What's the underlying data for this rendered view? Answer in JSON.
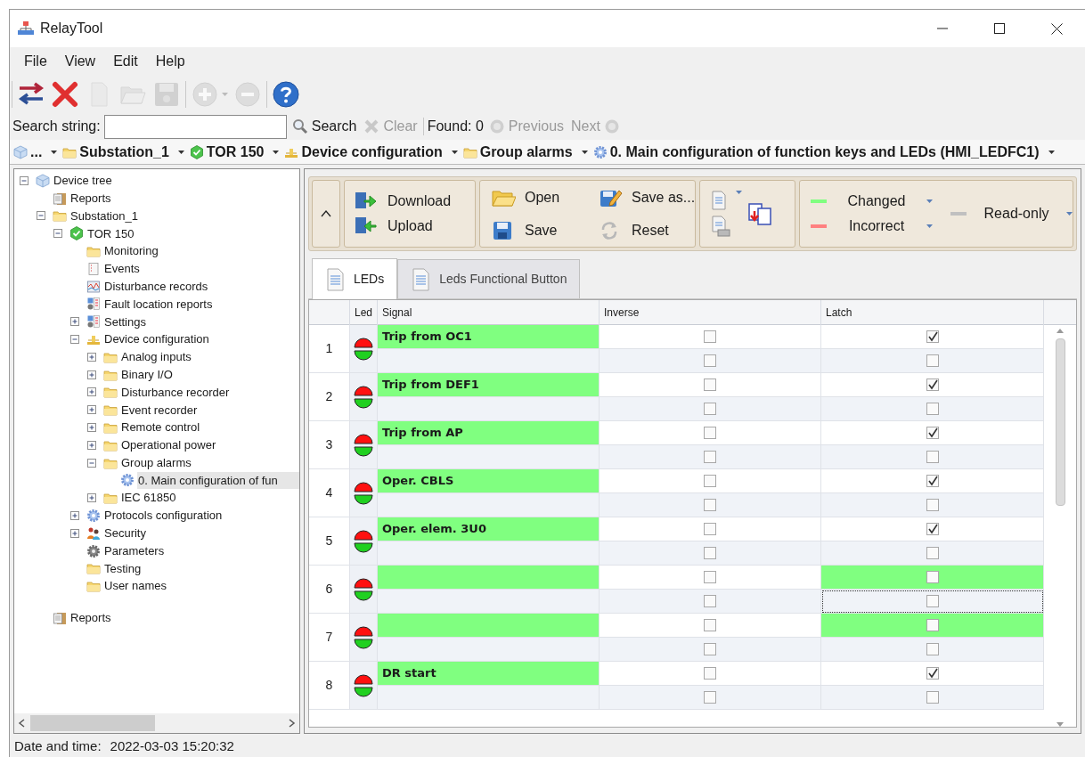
{
  "window": {
    "title": "RelayTool"
  },
  "menu": [
    "File",
    "View",
    "Edit",
    "Help"
  ],
  "toolbar": [
    {
      "kind": "swap",
      "disabled": false
    },
    {
      "kind": "delete",
      "disabled": false
    },
    {
      "kind": "new",
      "disabled": true
    },
    {
      "kind": "open",
      "disabled": true
    },
    {
      "kind": "save",
      "disabled": true
    },
    {
      "kind": "add",
      "disabled": true
    },
    {
      "kind": "remove",
      "disabled": true
    },
    {
      "kind": "help",
      "disabled": false
    }
  ],
  "search": {
    "label": "Search string:",
    "search_button": "Search",
    "clear_button": {
      "label": "Clear",
      "disabled": true
    },
    "found": "Found: 0",
    "previous_button": {
      "label": "Previous",
      "disabled": true
    },
    "next_button": {
      "label": "Next",
      "disabled": true
    }
  },
  "breadcrumb": [
    {
      "label": "...",
      "kind": "cube"
    },
    {
      "label": "Substation_1",
      "kind": "folder"
    },
    {
      "label": "TOR 150",
      "kind": "check"
    },
    {
      "label": "Device configuration",
      "kind": "device-config"
    },
    {
      "label": "Group alarms",
      "kind": "folder"
    },
    {
      "label": "0. Main configuration of function keys and LEDs (HMI_LEDFC1)",
      "kind": "gear"
    }
  ],
  "tree": [
    {
      "label": "Device tree",
      "kind": "cube",
      "expanded": true,
      "selected": false,
      "children": [
        {
          "label": "Reports",
          "kind": "report",
          "selected": false
        },
        {
          "label": "Substation_1",
          "kind": "folder",
          "expanded": true,
          "selected": false,
          "children": [
            {
              "label": "TOR 150",
              "kind": "check",
              "expanded": true,
              "selected": false,
              "children": [
                {
                  "label": "Monitoring",
                  "kind": "folder",
                  "selected": false
                },
                {
                  "label": "Events",
                  "kind": "events",
                  "selected": false
                },
                {
                  "label": "Disturbance records",
                  "kind": "disturbance",
                  "selected": false
                },
                {
                  "label": "Fault location reports",
                  "kind": "fault",
                  "selected": false
                },
                {
                  "label": "Settings",
                  "kind": "fault",
                  "expanded": false,
                  "selected": false
                },
                {
                  "label": "Device configuration",
                  "kind": "device-config",
                  "expanded": true,
                  "selected": false,
                  "children": [
                    {
                      "label": "Analog inputs",
                      "kind": "folder",
                      "expanded": false,
                      "selected": false
                    },
                    {
                      "label": "Binary I/O",
                      "kind": "folder",
                      "expanded": false,
                      "selected": false
                    },
                    {
                      "label": "Disturbance recorder",
                      "kind": "folder",
                      "expanded": false,
                      "selected": false
                    },
                    {
                      "label": "Event recorder",
                      "kind": "folder",
                      "expanded": false,
                      "selected": false
                    },
                    {
                      "label": "Remote control",
                      "kind": "folder",
                      "expanded": false,
                      "selected": false
                    },
                    {
                      "label": "Operational power",
                      "kind": "folder",
                      "expanded": false,
                      "selected": false
                    },
                    {
                      "label": "Group alarms",
                      "kind": "folder",
                      "expanded": true,
                      "selected": false,
                      "children": [
                        {
                          "label": "0. Main configuration of fun",
                          "kind": "gear",
                          "selected": true
                        }
                      ]
                    },
                    {
                      "label": "IEC 61850",
                      "kind": "folder",
                      "expanded": false,
                      "selected": false
                    }
                  ]
                },
                {
                  "label": "Protocols configuration",
                  "kind": "gear",
                  "expanded": false,
                  "selected": false
                },
                {
                  "label": "Security",
                  "kind": "people",
                  "expanded": false,
                  "selected": false
                },
                {
                  "label": "Parameters",
                  "kind": "parameters",
                  "selected": false
                },
                {
                  "label": "Testing",
                  "kind": "folder",
                  "selected": false
                },
                {
                  "label": "User names",
                  "kind": "folder",
                  "selected": false
                }
              ]
            }
          ]
        },
        {
          "label": "Reports",
          "kind": "report",
          "selected": false
        }
      ]
    }
  ],
  "ribbon": {
    "transfer": [
      {
        "label": "Download",
        "kind": "download"
      },
      {
        "label": "Upload",
        "kind": "upload"
      }
    ],
    "file": [
      {
        "label": "Open",
        "kind": "open"
      },
      {
        "label": "Save as...",
        "kind": "save-as"
      },
      {
        "label": "Save",
        "kind": "save"
      },
      {
        "label": "Reset",
        "kind": "reset"
      }
    ],
    "legend": [
      {
        "label": "Changed",
        "color": "#80ff80"
      },
      {
        "label": "Incorrect",
        "color": "#ff8080"
      },
      {
        "label": "Read-only",
        "color": "#c0c0c0"
      }
    ]
  },
  "tabs": [
    {
      "label": "LEDs",
      "selected": true
    },
    {
      "label": "Leds Functional Button",
      "selected": false
    }
  ],
  "table": {
    "columns": [
      "Led",
      "Signal",
      "Inverse",
      "Latch"
    ],
    "rows": [
      {
        "number": "1",
        "lines": [
          {
            "signal": "Trip from OC1",
            "signal_changed": true,
            "inverse": false,
            "latch": true,
            "latch_changed": false,
            "focused": false
          },
          {
            "signal_changed": false,
            "inverse": false,
            "latch": false,
            "latch_changed": false,
            "focused": false
          }
        ]
      },
      {
        "number": "2",
        "lines": [
          {
            "signal": "Trip from DEF1",
            "signal_changed": true,
            "inverse": false,
            "latch": true,
            "latch_changed": false,
            "focused": false
          },
          {
            "signal_changed": false,
            "inverse": false,
            "latch": false,
            "latch_changed": false,
            "focused": false
          }
        ]
      },
      {
        "number": "3",
        "lines": [
          {
            "signal": "Trip from AP",
            "signal_changed": true,
            "inverse": false,
            "latch": true,
            "latch_changed": false,
            "focused": false
          },
          {
            "signal_changed": false,
            "inverse": false,
            "latch": false,
            "latch_changed": false,
            "focused": false
          }
        ]
      },
      {
        "number": "4",
        "lines": [
          {
            "signal": "Oper. CBLS",
            "signal_changed": true,
            "inverse": false,
            "latch": true,
            "latch_changed": false,
            "focused": false
          },
          {
            "signal_changed": false,
            "inverse": false,
            "latch": false,
            "latch_changed": false,
            "focused": false
          }
        ]
      },
      {
        "number": "5",
        "lines": [
          {
            "signal": "Oper. elem. 3U0",
            "signal_changed": true,
            "inverse": false,
            "latch": true,
            "latch_changed": false,
            "focused": false
          },
          {
            "signal_changed": false,
            "inverse": false,
            "latch": false,
            "latch_changed": false,
            "focused": false
          }
        ]
      },
      {
        "number": "6",
        "lines": [
          {
            "signal_changed": true,
            "inverse": false,
            "latch": false,
            "latch_changed": true,
            "focused": false
          },
          {
            "signal_changed": false,
            "inverse": false,
            "latch": false,
            "latch_changed": false,
            "focused": true
          }
        ]
      },
      {
        "number": "7",
        "lines": [
          {
            "signal_changed": true,
            "inverse": false,
            "latch": false,
            "latch_changed": true,
            "focused": false
          },
          {
            "signal_changed": false,
            "inverse": false,
            "latch": false,
            "latch_changed": false,
            "focused": false
          }
        ]
      },
      {
        "number": "8",
        "lines": [
          {
            "signal": "DR start",
            "signal_changed": true,
            "inverse": false,
            "latch": true,
            "latch_changed": false,
            "focused": false
          },
          {
            "signal_changed": false,
            "inverse": false,
            "latch": false,
            "latch_changed": false,
            "focused": false
          }
        ]
      }
    ]
  },
  "status_bar": {
    "label": "Date and time:",
    "value": "2022-03-03 15:20:32"
  }
}
